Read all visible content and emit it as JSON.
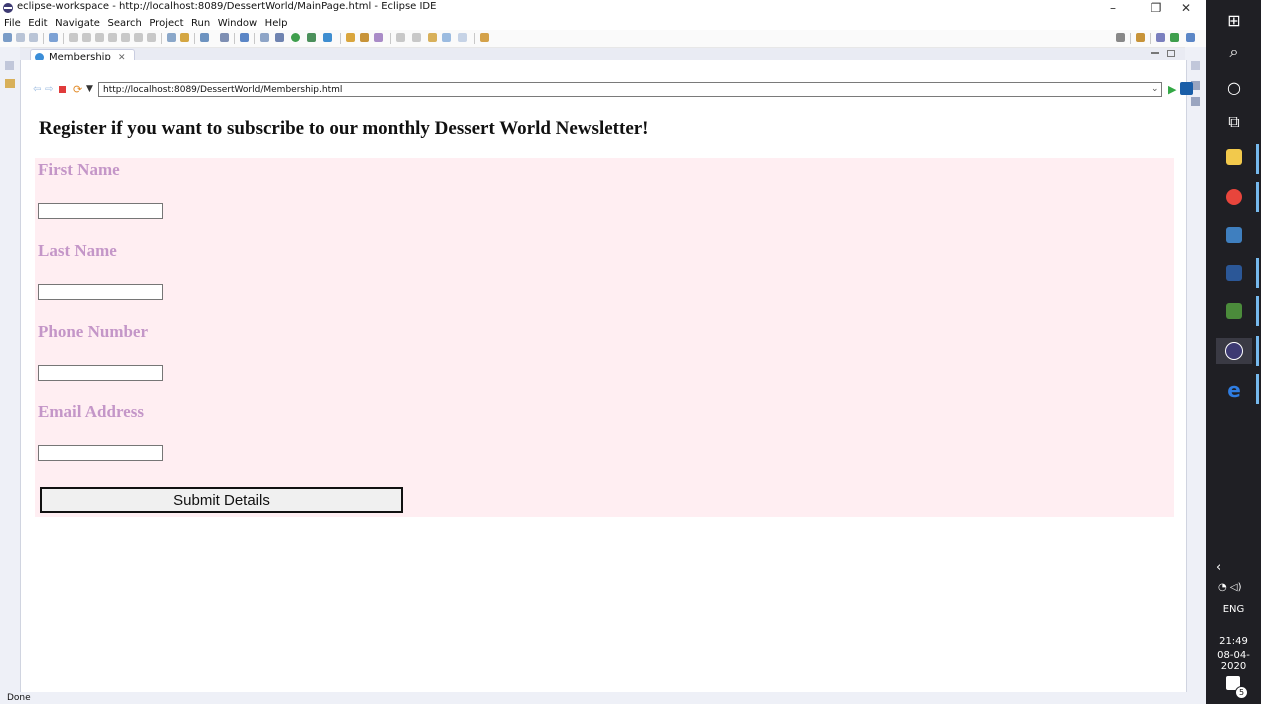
{
  "window": {
    "title": "eclipse-workspace - http://localhost:8089/DessertWorld/MainPage.html - Eclipse IDE",
    "minimize": "–",
    "maximize": "❐",
    "close": "✕"
  },
  "menu": [
    "File",
    "Edit",
    "Navigate",
    "Search",
    "Project",
    "Run",
    "Window",
    "Help"
  ],
  "editor_tab": {
    "label": "Membership",
    "close": "✕"
  },
  "browser": {
    "url": "http://localhost:8089/DessertWorld/Membership.html"
  },
  "page": {
    "heading": "Register if you want to subscribe to our monthly Dessert World Newsletter!",
    "fields": [
      {
        "label": "First Name",
        "value": ""
      },
      {
        "label": "Last Name",
        "value": ""
      },
      {
        "label": "Phone Number",
        "value": ""
      },
      {
        "label": "Email Address",
        "value": ""
      }
    ],
    "submit": "Submit Details"
  },
  "status": "Done",
  "taskbar": {
    "language": "ENG",
    "time": "21:49",
    "date": "08-04-2020",
    "notifications": "5"
  },
  "colors": {
    "form_background": "#ffeef2",
    "label_color": "#c496c8",
    "taskbar": "#1f1f24"
  }
}
